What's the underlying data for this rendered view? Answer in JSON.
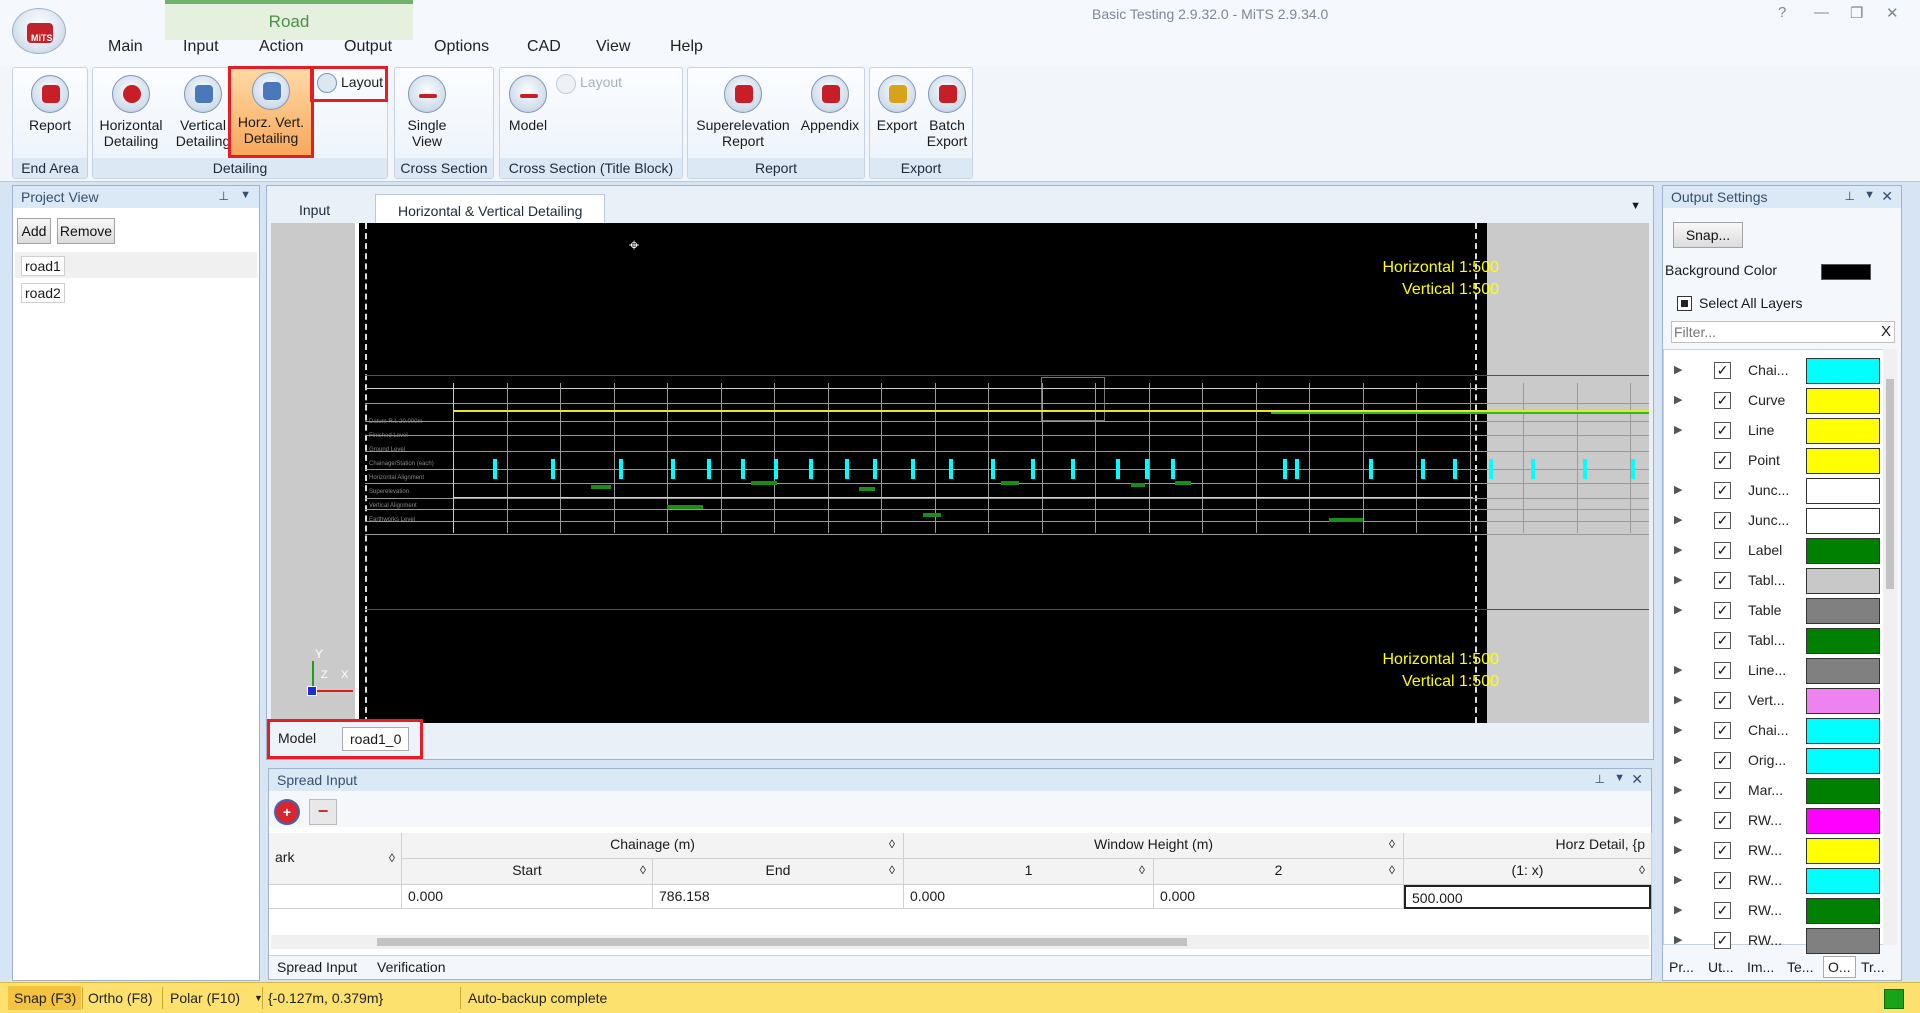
{
  "window": {
    "title": "Basic Testing 2.9.32.0 - MiTS 2.9.34.0",
    "help_icon": "?",
    "minimize_icon": "—",
    "restore_icon": "❐",
    "close_icon": "✕"
  },
  "ribbon": {
    "context_tab": "Road",
    "menu": [
      "Main",
      "Input",
      "Action",
      "Output",
      "Options",
      "CAD",
      "View",
      "Help"
    ],
    "groups": {
      "end_area": "End Area",
      "detailing": "Detailing",
      "cross_section": "Cross Section",
      "cross_section_title": "Cross Section (Title Block)",
      "report": "Report",
      "export": "Export"
    },
    "buttons": {
      "report": "Report",
      "horizontal_detailing": "Horizontal Detailing",
      "vertical_detailing": "Vertical Detailing",
      "horz_vert_detailing": "Horz. Vert. Detailing",
      "layout": "Layout",
      "single_view": "Single View",
      "model": "Model",
      "layout_disabled": "Layout",
      "superelevation_report": "Superelevation Report",
      "appendix": "Appendix",
      "export": "Export",
      "batch_export": "Batch Export"
    }
  },
  "project_view": {
    "title": "Project View",
    "add": "Add",
    "remove": "Remove",
    "items": [
      "road1",
      "road2"
    ]
  },
  "document": {
    "tabs": [
      "Input",
      "Horizontal & Vertical Detailing"
    ],
    "scale_top": [
      "Horizontal  1:500",
      "Vertical  1:500"
    ],
    "scale_bottom": [
      "Horizontal  1:500",
      "Vertical  1:500"
    ],
    "axis_y": "Y",
    "axis_z": "Z",
    "axis_x": "X",
    "row_labels": [
      "Datum R.L 20.000m",
      "Finished Level",
      "Ground Level",
      "Chainage/Station (each)",
      "Horizontal Alignment",
      "Superelevation",
      "Vertical Alignment",
      "Earthworks Level"
    ],
    "bottom_tabs": [
      "Model",
      "road1_0"
    ]
  },
  "spread_input": {
    "title": "Spread Input",
    "add_icon": "+",
    "remove_icon": "−",
    "headers_top": [
      "ark",
      "Chainage (m)",
      "Window Height (m)",
      "Horz Detail, {p"
    ],
    "headers_sub": [
      "Start",
      "End",
      "1",
      "2",
      "(1: x)"
    ],
    "row": [
      "",
      "0.000",
      "786.158",
      "0.000",
      "0.000",
      "500.000"
    ],
    "bottom_tabs": [
      "Spread Input",
      "Verification"
    ],
    "sort_icon": "◊"
  },
  "output_settings": {
    "title": "Output Settings",
    "snap": "Snap...",
    "bg_label": "Background Color",
    "bg_color": "#000000",
    "select_all": "Select All Layers",
    "filter_placeholder": "Filter...",
    "clear": "X",
    "layers": [
      {
        "name": "Chai...",
        "color": "#00ffff",
        "expand": true
      },
      {
        "name": "Curve",
        "color": "#ffff00",
        "expand": true
      },
      {
        "name": "Line",
        "color": "#ffff00",
        "expand": true
      },
      {
        "name": "Point",
        "color": "#ffff00",
        "expand": false
      },
      {
        "name": "Junc...",
        "color": "#ffffff",
        "expand": true
      },
      {
        "name": "Junc...",
        "color": "#ffffff",
        "expand": true
      },
      {
        "name": "Label",
        "color": "#008000",
        "expand": true
      },
      {
        "name": "Tabl...",
        "color": "#c8c8c8",
        "expand": true
      },
      {
        "name": "Table",
        "color": "#808080",
        "expand": true
      },
      {
        "name": "Tabl...",
        "color": "#008000",
        "expand": false
      },
      {
        "name": "Line...",
        "color": "#808080",
        "expand": true
      },
      {
        "name": "Vert...",
        "color": "#ee82ee",
        "expand": true
      },
      {
        "name": "Chai...",
        "color": "#00ffff",
        "expand": true
      },
      {
        "name": "Orig...",
        "color": "#00ffff",
        "expand": true
      },
      {
        "name": "Mar...",
        "color": "#008000",
        "expand": true
      },
      {
        "name": "RW...",
        "color": "#ff00ff",
        "expand": true
      },
      {
        "name": "RW...",
        "color": "#ffff00",
        "expand": true
      },
      {
        "name": "RW...",
        "color": "#00ffff",
        "expand": true
      },
      {
        "name": "RW...",
        "color": "#008000",
        "expand": true
      },
      {
        "name": "RW...",
        "color": "#808080",
        "expand": true
      }
    ],
    "bottom_tabs": [
      "Pr...",
      "Ut...",
      "Im...",
      "Te...",
      "O...",
      "Tr..."
    ]
  },
  "status": {
    "snap": "Snap (F3)",
    "ortho": "Ortho (F8)",
    "polar": "Polar (F10)",
    "coords": "{-0.127m, 0.379m}",
    "message": "Auto-backup complete"
  }
}
